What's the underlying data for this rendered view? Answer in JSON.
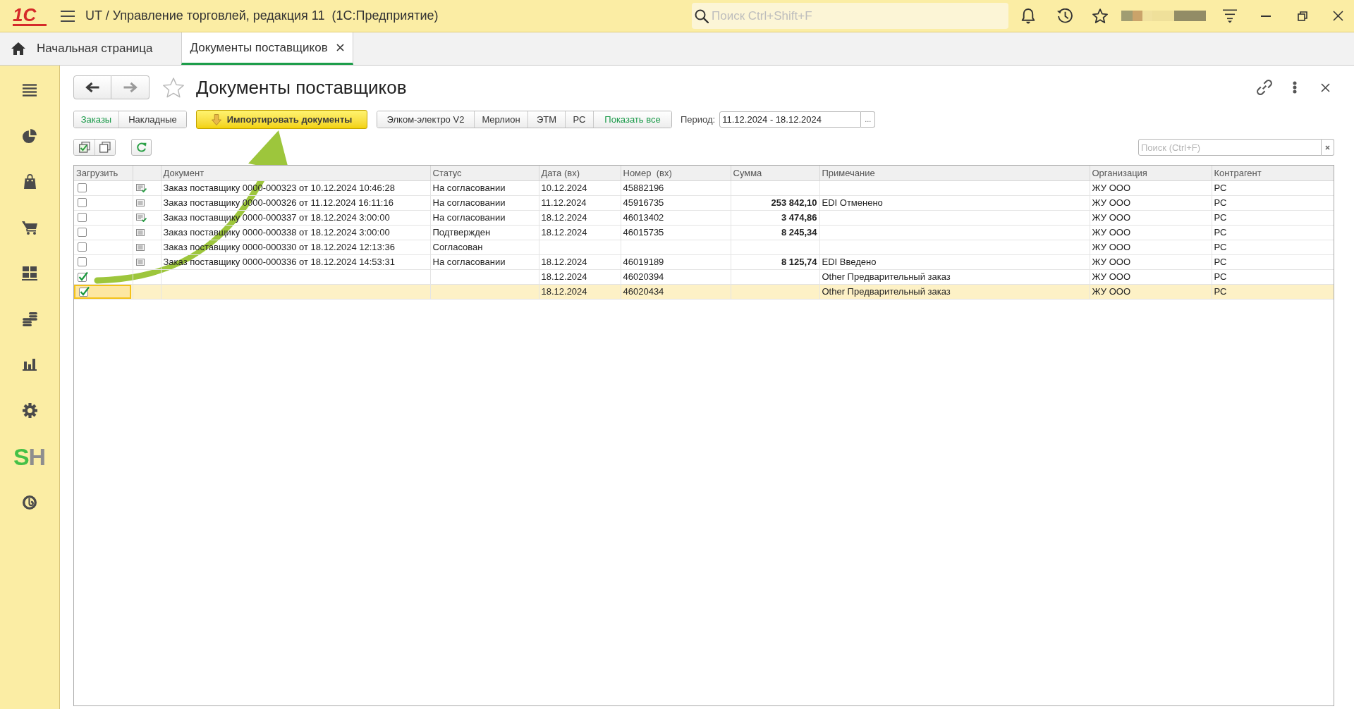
{
  "app": {
    "logo": "1С",
    "title": "UT / Управление торговлей, редакция 11  (1С:Предприятие)",
    "search": {
      "placeholder": "Поиск Ctrl+Shift+F"
    }
  },
  "tabs": [
    {
      "kind": "home",
      "label": "Начальная страница",
      "selected": false
    },
    {
      "kind": "page",
      "label": "Документы поставщиков",
      "selected": true
    }
  ],
  "sidebar": {
    "logo_letters": [
      {
        "char": "S",
        "color": "#44c046"
      },
      {
        "char": "H",
        "color": "#8e8e8e"
      }
    ]
  },
  "page": {
    "title": "Документы поставщиков",
    "favorite": false,
    "back": {
      "disabled": false
    },
    "forward": {
      "disabled": true
    }
  },
  "filters": {
    "document_types": [
      {
        "label": "Заказы",
        "selected": true
      },
      {
        "label": "Накладные",
        "selected": false
      }
    ],
    "import_button": "Импортировать документы",
    "suppliers": [
      {
        "label": "Элком-электро V2",
        "selected": false
      },
      {
        "label": "Мерлион",
        "selected": false
      },
      {
        "label": "ЭТМ",
        "selected": false
      },
      {
        "label": "РС",
        "selected": false
      },
      {
        "label": "Показать все",
        "selected": true
      }
    ],
    "period": {
      "label": "Период:",
      "value": "11.12.2024 - 18.12.2024",
      "button": "..."
    }
  },
  "table_search": {
    "placeholder": "Поиск (Ctrl+F)"
  },
  "table": {
    "columns": [
      "Загрузить",
      "Документ",
      "Статус",
      "Дата (вх)",
      "Номер  (вх)",
      "Сумма",
      "Примечание",
      "Организация",
      "Контрагент"
    ],
    "rows": [
      {
        "kind": "posted",
        "load": false,
        "selected": false,
        "document": "Заказ поставщику 0000-000323 от 10.12.2024 10:46:28",
        "status": "На согласовании",
        "date": "10.12.2024",
        "number": "45882196",
        "organization": "ЖУ ООО",
        "counterparty": "РС"
      },
      {
        "kind": "unposted",
        "load": false,
        "selected": false,
        "document": "Заказ поставщику 0000-000326 от 11.12.2024 16:11:16",
        "status": "На согласовании",
        "date": "11.12.2024",
        "number": "45916735",
        "sum": "253 842,10",
        "note": "EDI Отменено",
        "organization": "ЖУ ООО",
        "counterparty": "РС"
      },
      {
        "kind": "posted",
        "load": false,
        "selected": false,
        "document": "Заказ поставщику 0000-000337 от 18.12.2024 3:00:00",
        "status": "На согласовании",
        "date": "18.12.2024",
        "number": "46013402",
        "sum": "3 474,86",
        "organization": "ЖУ ООО",
        "counterparty": "РС"
      },
      {
        "kind": "unposted",
        "load": false,
        "selected": false,
        "document": "Заказ поставщику 0000-000338 от 18.12.2024 3:00:00",
        "status": "Подтвержден",
        "date": "18.12.2024",
        "number": "46015735",
        "sum": "8 245,34",
        "organization": "ЖУ ООО",
        "counterparty": "РС"
      },
      {
        "kind": "unposted",
        "load": false,
        "selected": false,
        "document": "Заказ поставщику 0000-000330 от 18.12.2024 12:13:36",
        "status": "Согласован",
        "organization": "ЖУ ООО",
        "counterparty": "РС"
      },
      {
        "kind": "unposted",
        "load": false,
        "selected": false,
        "document": "Заказ поставщику 0000-000336 от 18.12.2024 14:53:31",
        "status": "На согласовании",
        "date": "18.12.2024",
        "number": "46019189",
        "sum": "8 125,74",
        "note": "EDI Введено",
        "organization": "ЖУ ООО",
        "counterparty": "РС"
      },
      {
        "kind": "new",
        "load": true,
        "selected": false,
        "date": "18.12.2024",
        "number": "46020394",
        "note": "Other Предварительный заказ",
        "organization": "ЖУ ООО",
        "counterparty": "РС"
      },
      {
        "kind": "new",
        "load": true,
        "selected": true,
        "date": "18.12.2024",
        "number": "46020434",
        "note": "Other Предварительный заказ",
        "organization": "ЖУ ООО",
        "counterparty": "РС"
      }
    ]
  }
}
